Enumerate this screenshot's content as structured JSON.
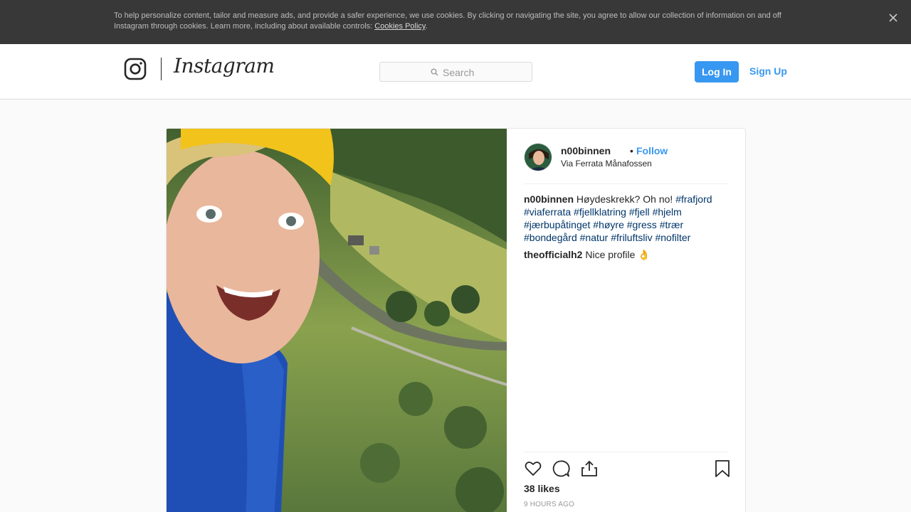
{
  "cookie_banner": {
    "text": "To help personalize content, tailor and measure ads, and provide a safer experience, we use cookies. By clicking or navigating the site, you agree to allow our collection of information on and off Instagram through cookies. Learn more, including about available controls: ",
    "link": "Cookies Policy",
    "end": ".",
    "close_icon": "close-icon"
  },
  "header": {
    "wordmark": "Instagram",
    "search_placeholder": "Search",
    "login": "Log In",
    "signup": "Sign Up"
  },
  "post": {
    "username": "n00binnen",
    "separator": "•",
    "follow": "Follow",
    "location": "Via Ferrata Månafossen",
    "caption_text": "Høydeskrekk? Oh no!",
    "hashtags": [
      "#frafjord",
      "#viaferrata",
      "#fjellklatring",
      "#fjell",
      "#hjelm",
      "#jærbupåtinget",
      "#høyre",
      "#gress",
      "#trær",
      "#bondegård",
      "#natur",
      "#friluftsliv",
      "#nofilter"
    ],
    "comment": {
      "user": "theofficialh2",
      "text": "Nice profile 👌"
    },
    "likes": "38 likes",
    "time": "9 HOURS AGO"
  },
  "colors": {
    "accent": "#3897f0",
    "hashtag": "#003569",
    "banner": "#383838"
  }
}
